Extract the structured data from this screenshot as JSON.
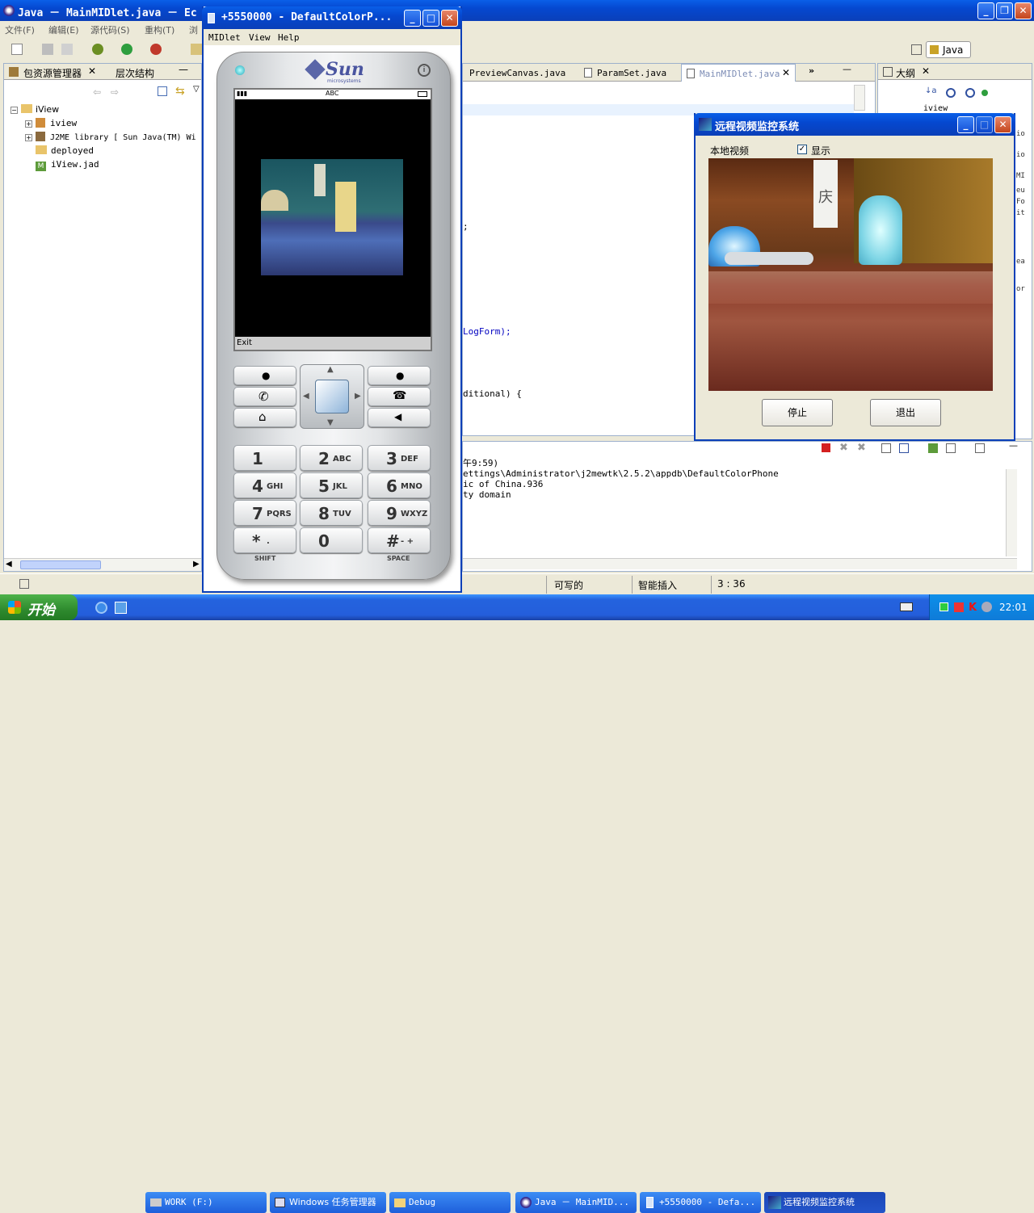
{
  "eclipse": {
    "title": "Java － MainMIDlet.java － Ec",
    "menu": [
      "文件(F)",
      "编辑(E)",
      "源代码(S)",
      "重构(T)",
      "浏"
    ],
    "perspective": "Java",
    "package_explorer": {
      "tabs": [
        "包资源管理器",
        "层次结构"
      ],
      "tree": [
        "iView",
        "iview",
        "J2ME library [ Sun Java(TM) Wi",
        "deployed",
        "iView.jad"
      ]
    },
    "editor_tabs": [
      "PreviewCanvas.java",
      "ParamSet.java",
      "MainMIDlet.java"
    ],
    "outline": {
      "tab": "大纲",
      "item": "iview"
    },
    "code_fragments": [
      ";",
      "LogForm);",
      "ditional) {"
    ],
    "console_lines": [
      "午9:59)",
      "ettings\\Administrator\\j2mewtk\\2.5.2\\appdb\\DefaultColorPhone",
      "ic of China.936",
      "ty domain"
    ],
    "right_fragments": [
      "io",
      "io",
      "MI",
      "eu",
      "Fo",
      "it",
      "ea",
      "or"
    ],
    "status": {
      "writable": "可写的",
      "insert": "智能插入",
      "position": "3 : 36"
    }
  },
  "emulator": {
    "title": "+5550000 - DefaultColorP...",
    "menu": [
      "MIDlet",
      "View",
      "Help"
    ],
    "brand": "Sun",
    "brand_sub": "microsystems",
    "screen_status": "ABC",
    "softkey": "Exit",
    "keys": [
      {
        "n": "1",
        "s": ""
      },
      {
        "n": "2",
        "s": "ABC"
      },
      {
        "n": "3",
        "s": "DEF"
      },
      {
        "n": "4",
        "s": "GHI"
      },
      {
        "n": "5",
        "s": "JKL"
      },
      {
        "n": "6",
        "s": "MNO"
      },
      {
        "n": "7",
        "s": "PQRS"
      },
      {
        "n": "8",
        "s": "TUV"
      },
      {
        "n": "9",
        "s": "WXYZ"
      },
      {
        "n": "*",
        "s": "."
      },
      {
        "n": "0",
        "s": ""
      },
      {
        "n": "#",
        "s": "- +"
      }
    ],
    "shift_label": "SHIFT",
    "space_label": "SPACE"
  },
  "monitor": {
    "title": "远程视频监控系统",
    "local_label": "本地视频",
    "show_label": "显示",
    "stop_button": "停止",
    "exit_button": "退出",
    "sign_char": "庆"
  },
  "taskbar": {
    "start": "开始",
    "items": [
      "WORK (F:)",
      "Windows 任务管理器",
      "Debug",
      "Java － MainMID...",
      "+5550000 - Defa...",
      "远程视频监控系统"
    ],
    "clock": "22:01"
  }
}
